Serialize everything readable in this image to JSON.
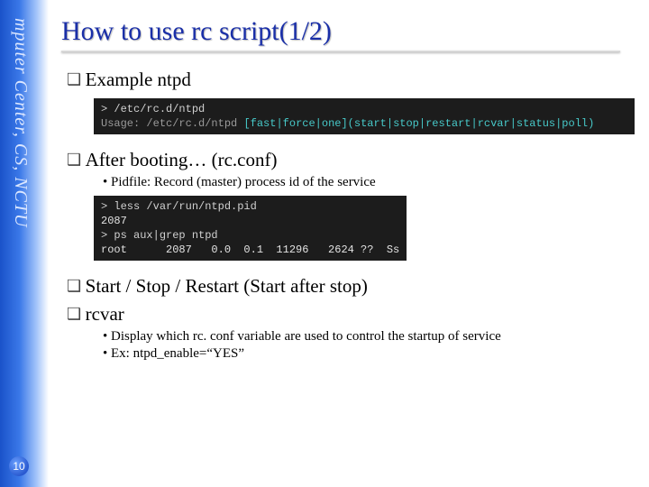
{
  "sidebar": {
    "text": "mputer Center, CS, NCTU"
  },
  "pagenum": "10",
  "title": "How to use rc script(1/2)",
  "sections": {
    "s0": {
      "heading": "Example ntpd"
    },
    "s1": {
      "heading": "After booting… (rc.conf)",
      "bullets": {
        "b0": "Pidfile: Record (master) process id of the service"
      }
    },
    "s2": {
      "heading": "Start / Stop / Restart (Start after stop)"
    },
    "s3": {
      "heading": "rcvar",
      "bullets": {
        "b0": "Display which rc. conf variable are used to control the startup of service",
        "b1": "Ex: ntpd_enable=“YES”"
      }
    }
  },
  "terminal1": {
    "prompt": "> ",
    "cmd": "/etc/rc.d/ntpd",
    "usage_label": "Usage: ",
    "usage_path": "/etc/rc.d/ntpd ",
    "usage_opts": "[fast|force|one](start|stop|restart|rcvar|status|poll)"
  },
  "terminal2": {
    "lines": {
      "l0_prompt": "> ",
      "l0_cmd": "less /var/run/ntpd.pid",
      "l1": "2087",
      "l2_prompt": "> ",
      "l2_cmd": "ps aux|grep ntpd",
      "l3": "root      2087   0.0  0.1  11296   2624 ??  Ss"
    }
  }
}
